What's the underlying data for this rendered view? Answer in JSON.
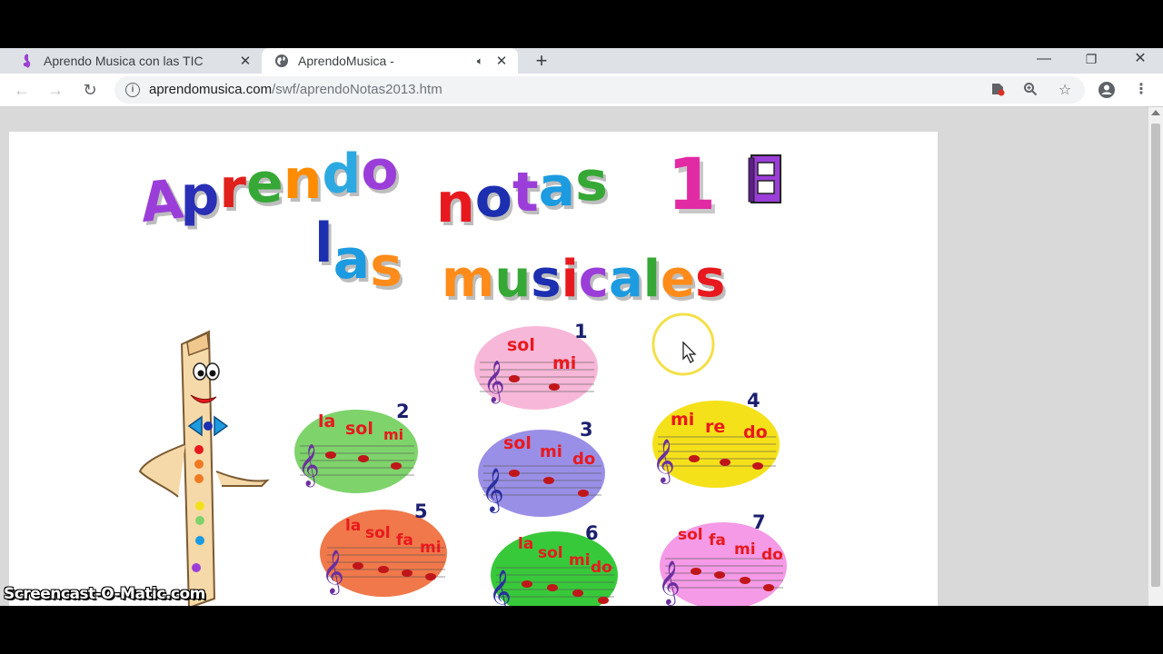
{
  "tabs": [
    {
      "title": "Aprendo Musica con las TIC",
      "icon": "music-icon",
      "active": false
    },
    {
      "title": "AprendoMusica -",
      "icon": "globe-icon",
      "active": true,
      "audio": true
    }
  ],
  "address_bar": {
    "host": "aprendomusica.com",
    "path": "/swf/aprendoNotas2013.htm"
  },
  "page": {
    "title_words": [
      "Aprendo",
      "las",
      "notas",
      "musicales"
    ],
    "level": "1",
    "lessons": [
      {
        "number": "1",
        "notes": [
          "sol",
          "mi"
        ],
        "color": "#f7b7d8"
      },
      {
        "number": "2",
        "notes": [
          "la",
          "sol",
          "mi"
        ],
        "color": "#7ed36b"
      },
      {
        "number": "3",
        "notes": [
          "sol",
          "mi",
          "do"
        ],
        "color": "#9a8fe6"
      },
      {
        "number": "4",
        "notes": [
          "mi",
          "re",
          "do"
        ],
        "color": "#f5e11a"
      },
      {
        "number": "5",
        "notes": [
          "la",
          "sol",
          "fa",
          "mi"
        ],
        "color": "#f0784a"
      },
      {
        "number": "6",
        "notes": [
          "la",
          "sol",
          "mi",
          "do"
        ],
        "color": "#38c93a"
      },
      {
        "number": "7",
        "notes": [
          "sol",
          "fa",
          "mi",
          "do"
        ],
        "color": "#f59ae6"
      }
    ]
  },
  "watermark": "Screencast-O-Matic.com",
  "colors": {
    "tab_bar": "#dee1e6",
    "page_background": "#d9d9d9",
    "note_red": "#e8191e",
    "number_navy": "#1b1f6e"
  }
}
